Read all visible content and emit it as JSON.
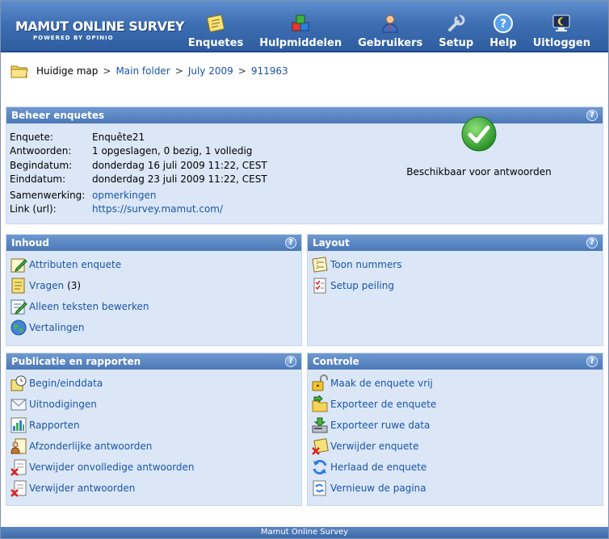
{
  "app": {
    "logo_main": "MAMUT ONLINE SURVEY",
    "logo_sub": "POWERED BY OPINIO"
  },
  "nav": [
    {
      "label": "Enquetes",
      "icon": "survey-icon"
    },
    {
      "label": "Hulpmiddelen",
      "icon": "blocks-icon"
    },
    {
      "label": "Gebruikers",
      "icon": "user-icon"
    },
    {
      "label": "Setup",
      "icon": "wrench-icon"
    },
    {
      "label": "Help",
      "icon": "help-icon"
    },
    {
      "label": "Uitloggen",
      "icon": "logout-icon"
    }
  ],
  "breadcrumb": {
    "current": "Huidige map",
    "items": [
      "Main folder",
      "July 2009",
      "911963"
    ]
  },
  "beheer": {
    "title": "Beheer enquetes",
    "rows": [
      {
        "label": "Enquete:",
        "value": "Enquête21"
      },
      {
        "label": "Antwoorden:",
        "value": "1 opgeslagen, 0 bezig, 1 volledig"
      },
      {
        "label": "Begindatum:",
        "value": "donderdag 16 juli 2009 11:22, CEST"
      },
      {
        "label": "Einddatum:",
        "value": "donderdag 23 juli 2009 11:22, CEST"
      }
    ],
    "samenwerking_label": "Samenwerking:",
    "samenwerking_value": "opmerkingen",
    "link_label": "Link (url):",
    "link_value": "https://survey.mamut.com/",
    "status": "Beschikbaar voor antwoorden"
  },
  "inhoud": {
    "title": "Inhoud",
    "items": [
      {
        "label": "Attributen enquete",
        "icon": "edit-attributes-icon"
      },
      {
        "label": "Vragen",
        "count": "(3)",
        "icon": "questions-icon"
      },
      {
        "label": "Alleen teksten bewerken",
        "icon": "edit-text-icon"
      },
      {
        "label": "Vertalingen",
        "icon": "globe-icon"
      }
    ]
  },
  "layout": {
    "title": "Layout",
    "items": [
      {
        "label": "Toon nummers",
        "icon": "numbers-icon"
      },
      {
        "label": "Setup peiling",
        "icon": "checklist-icon"
      }
    ]
  },
  "publicatie": {
    "title": "Publicatie en rapporten",
    "items": [
      {
        "label": "Begin/einddata",
        "icon": "clock-icon"
      },
      {
        "label": "Uitnodigingen",
        "icon": "envelope-icon"
      },
      {
        "label": "Rapporten",
        "icon": "chart-icon"
      },
      {
        "label": "Afzonderlijke antwoorden",
        "icon": "person-document-icon"
      },
      {
        "label": "Verwijder onvolledige antwoorden",
        "icon": "delete-document-icon"
      },
      {
        "label": "Verwijder antwoorden",
        "icon": "delete-document-icon"
      }
    ]
  },
  "controle": {
    "title": "Controle",
    "items": [
      {
        "label": "Maak de enquete vrij",
        "icon": "unlock-icon"
      },
      {
        "label": "Exporteer de enquete",
        "icon": "export-folder-icon"
      },
      {
        "label": "Exporteer ruwe data",
        "icon": "export-data-icon"
      },
      {
        "label": "Verwijder enquete",
        "icon": "delete-survey-icon"
      },
      {
        "label": "Herlaad de enquete",
        "icon": "reload-icon"
      },
      {
        "label": "Vernieuw de pagina",
        "icon": "refresh-page-icon"
      }
    ]
  },
  "footer": "Mamut Online Survey"
}
